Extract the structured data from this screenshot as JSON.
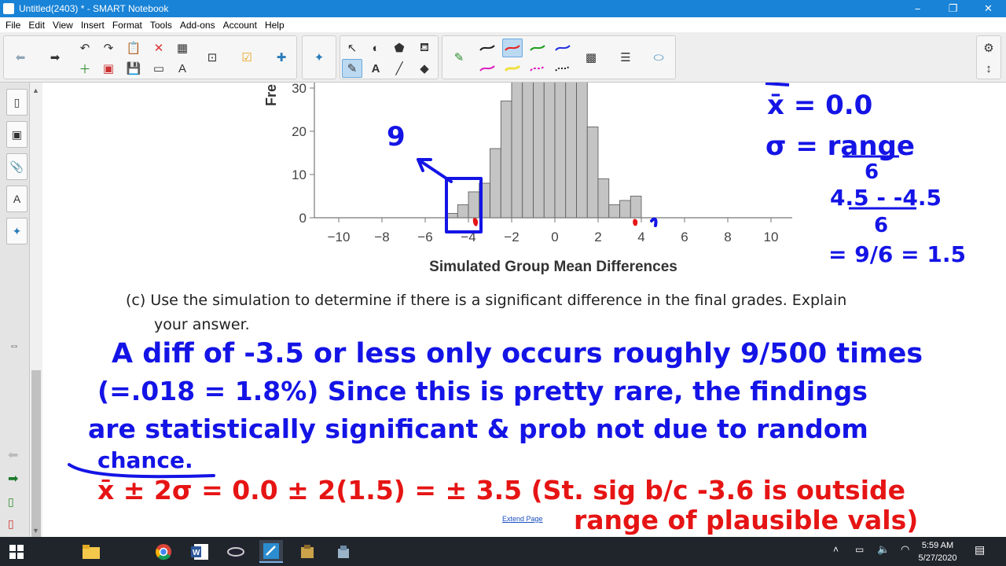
{
  "window": {
    "title": "Untitled(2403) * - SMART Notebook",
    "minimize": "−",
    "maximize": "❐",
    "close": "✕"
  },
  "menu": [
    "File",
    "Edit",
    "View",
    "Insert",
    "Format",
    "Tools",
    "Add-ons",
    "Account",
    "Help"
  ],
  "chart_data": {
    "type": "bar",
    "xlabel": "Simulated Group Mean Differences",
    "ylabel": "Fre",
    "x_ticks": [
      "−10",
      "−8",
      "−6",
      "−4",
      "−2",
      "0",
      "2",
      "4",
      "6",
      "8",
      "10"
    ],
    "y_ticks": [
      "0",
      "10",
      "20",
      "30"
    ],
    "xlim": [
      -10,
      10
    ],
    "ylim": [
      0,
      30
    ],
    "bin_width": 0.5,
    "bins": [
      {
        "x": -4.5,
        "y": 1
      },
      {
        "x": -4.0,
        "y": 3
      },
      {
        "x": -3.5,
        "y": 6
      },
      {
        "x": -3.0,
        "y": 8
      },
      {
        "x": -2.5,
        "y": 16
      },
      {
        "x": -2.0,
        "y": 27
      },
      {
        "x": -1.5,
        "y": 32
      },
      {
        "x": -1.0,
        "y": 32
      },
      {
        "x": -0.5,
        "y": 32
      },
      {
        "x": 0.0,
        "y": 32
      },
      {
        "x": 0.5,
        "y": 32
      },
      {
        "x": 1.0,
        "y": 32
      },
      {
        "x": 1.5,
        "y": 32
      },
      {
        "x": 2.0,
        "y": 21
      },
      {
        "x": 2.5,
        "y": 9
      },
      {
        "x": 3.0,
        "y": 3
      },
      {
        "x": 3.5,
        "y": 4
      },
      {
        "x": 4.0,
        "y": 5
      }
    ]
  },
  "question": {
    "label": "(c)",
    "line1": "Use the simulation to determine if there is a significant difference in the final grades. Explain",
    "line2": "your answer."
  },
  "ink": {
    "blue_right": [
      "x̄ = 0.0",
      "σ = range",
      "6",
      "4.5 - -4.5",
      "6",
      "= 9/6 = 1.5"
    ],
    "blue_chart_note": "9",
    "blue_answer": [
      "A diff of -3.5 or less only occurs roughly 9/500 times",
      "(=.018 = 1.8%) Since this is pretty rare, the findings",
      "are statistically significant & prob not due to random",
      "chance."
    ],
    "red_answer": [
      "x̄ ± 2σ = 0.0 ± 2(1.5) = ± 3.5 (St. sig b/c -3.6 is outside",
      "range of plausible vals)"
    ]
  },
  "extend_page": "Extend Page",
  "clock": {
    "time": "5:59 AM",
    "date": "5/27/2020"
  },
  "colors": {
    "titlebar": "#1883d7",
    "ink_blue": "#1414e6",
    "ink_red": "#e61414",
    "bar": "#c4c4c4"
  }
}
